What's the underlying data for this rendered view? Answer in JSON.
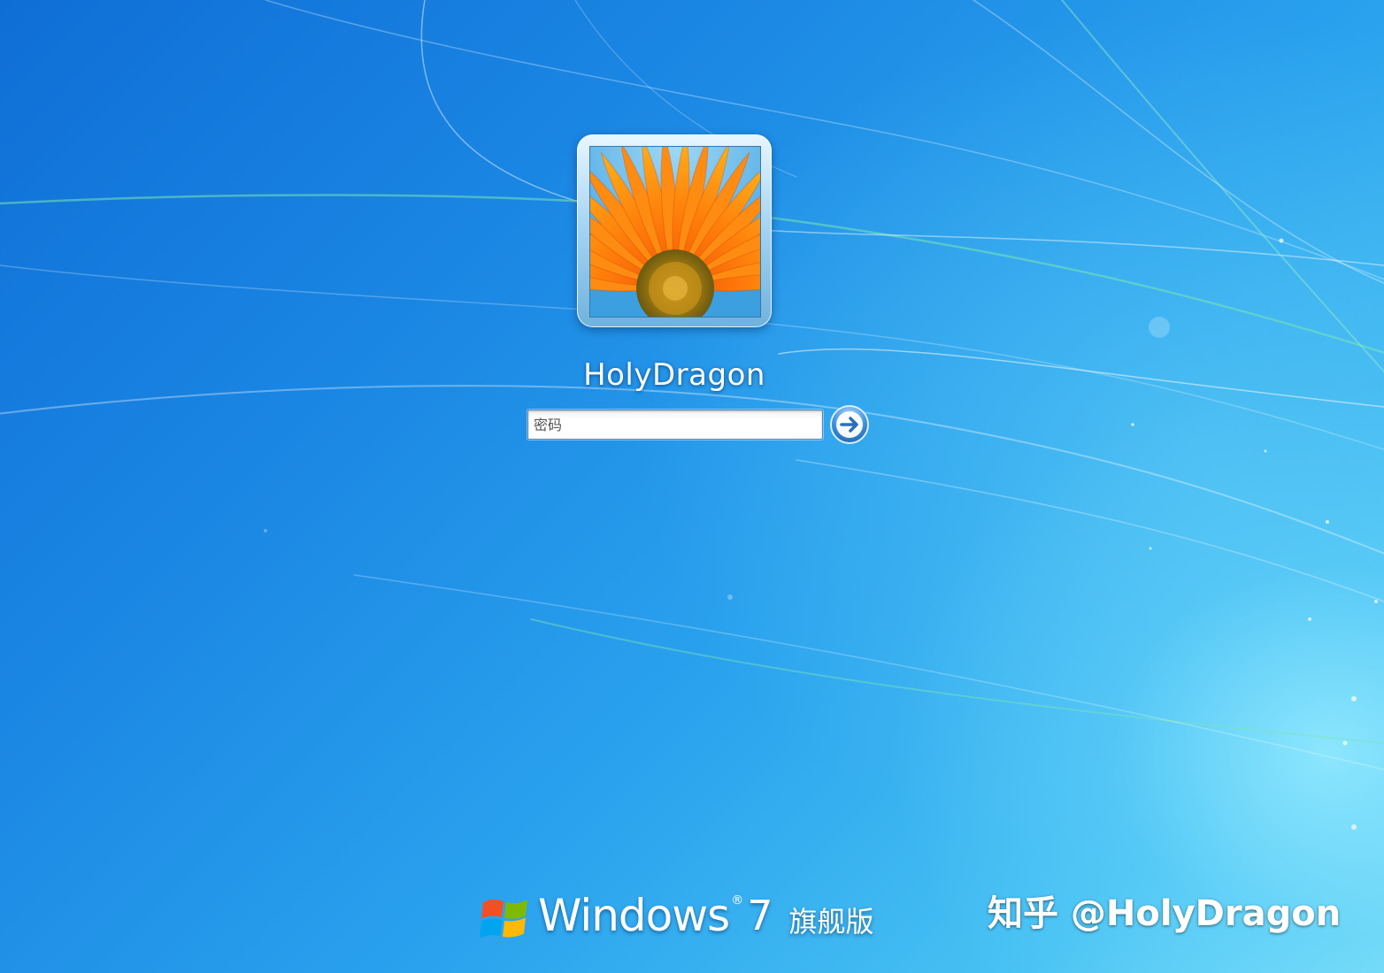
{
  "login": {
    "username": "HolyDragon",
    "password_placeholder": "密码",
    "submit_icon": "arrow-right-icon"
  },
  "avatar": {
    "icon": "flower-avatar"
  },
  "branding": {
    "windows_word": "Windows",
    "version": "7",
    "edition": "旗舰版",
    "logo_icon": "windows-flag-icon"
  },
  "watermark": {
    "text": "知乎 @HolyDragon"
  },
  "colors": {
    "background_dark": "#0f6ed6",
    "background_light": "#7ee0f8",
    "text": "#ffffff"
  }
}
